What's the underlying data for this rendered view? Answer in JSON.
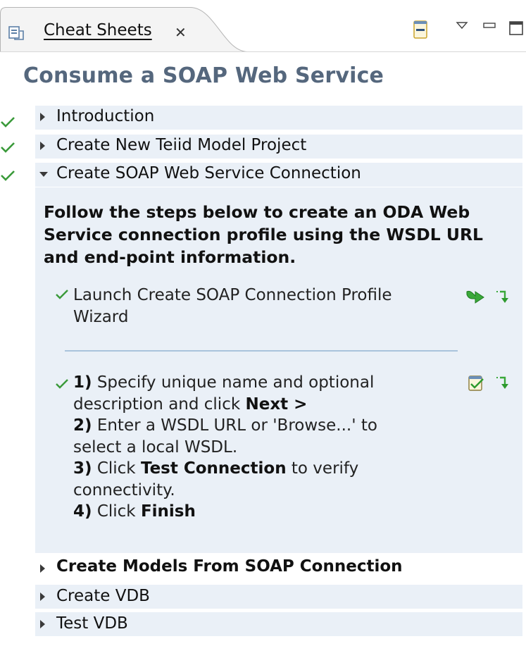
{
  "tab": {
    "title": "Cheat Sheets",
    "close_glyph": "✕",
    "icon": "cheatsheet-view-icon"
  },
  "toolbar": {
    "icons": [
      "collapse-all-icon",
      "view-menu-icon",
      "minimize-icon",
      "maximize-icon"
    ]
  },
  "sheet": {
    "title": "Consume a SOAP Web Service",
    "items": [
      {
        "label": "Introduction",
        "completed": true,
        "expanded": false
      },
      {
        "label": "Create New Teiid Model Project",
        "completed": true,
        "expanded": false
      },
      {
        "label": "Create SOAP Web Service Connection",
        "completed": true,
        "expanded": true
      },
      {
        "label": "Create Models From SOAP Connection",
        "completed": false,
        "expanded": false,
        "current": true
      },
      {
        "label": "Create VDB",
        "completed": false,
        "expanded": false
      },
      {
        "label": "Test VDB",
        "completed": false,
        "expanded": false
      }
    ],
    "expanded_item": {
      "intro": "Follow the steps below to create an ODA Web Service connection profile using the WSDL URL and end-point information.",
      "substep1": {
        "text": "Launch Create SOAP Connection Profile Wizard",
        "completed": true,
        "icons": [
          "launch-wizard-icon",
          "skip-step-icon"
        ]
      },
      "substep2": {
        "completed": true,
        "icons": [
          "mark-complete-icon",
          "skip-step-icon"
        ],
        "lines": [
          {
            "n": "1)",
            "pre": " Specify unique name and optional",
            "bold": "",
            "post": ""
          },
          {
            "n": "",
            "pre": "description and click ",
            "bold": "Next >",
            "post": ""
          },
          {
            "n": "2)",
            "pre": " Enter a WSDL URL or 'Browse...' to",
            "bold": "",
            "post": ""
          },
          {
            "n": "",
            "pre": "select a local WSDL.",
            "bold": "",
            "post": ""
          },
          {
            "n": "3)",
            "pre": " Click ",
            "bold": "Test Connection",
            "post": " to verify"
          },
          {
            "n": "",
            "pre": "connectivity.",
            "bold": "",
            "post": ""
          },
          {
            "n": "4)",
            "pre": " Click ",
            "bold": "Finish",
            "post": ""
          }
        ]
      }
    }
  },
  "colors": {
    "title": "#55677d",
    "row_background": "#eaf0f7",
    "check": "#3a9a3a",
    "action_green": "#2e9a2e"
  }
}
